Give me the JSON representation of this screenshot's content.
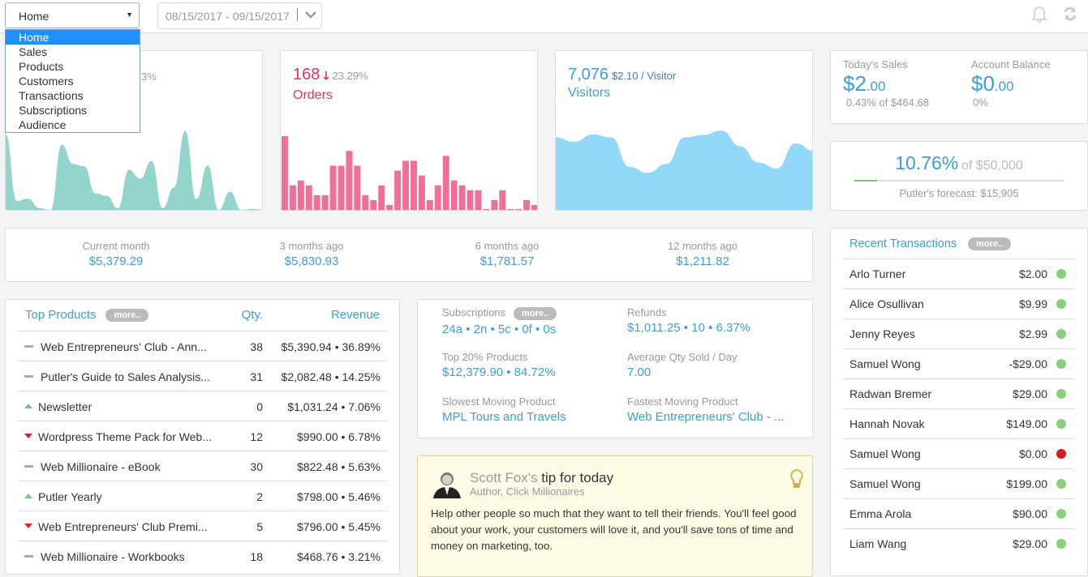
{
  "nav": {
    "selected": "Home",
    "options": [
      "Home",
      "Sales",
      "Products",
      "Customers",
      "Transactions",
      "Subscriptions",
      "Audience"
    ],
    "date_start": "08/15/2017",
    "date_sep": "-",
    "date_end": "09/15/2017"
  },
  "icons": {
    "bell": "bell-icon",
    "refresh": "refresh-icon",
    "chevron": "chevron-down-icon",
    "bulb": "lightbulb-icon"
  },
  "colors": {
    "accent": "#3d9de0",
    "orders": "#f06f97",
    "orders_text": "#e8335b",
    "sales": "#93d5cc",
    "visitors": "#92d9f9",
    "up": "#7bc67b",
    "down": "#dd2222",
    "success": "#86d17a",
    "fail": "#dd1a1a"
  },
  "sales": {
    "change_fragment": "3%"
  },
  "orders": {
    "count": "168",
    "change": "23.29%",
    "label": "Orders",
    "direction": "down"
  },
  "visitors": {
    "count": "7,076",
    "per_visitor": "$2.10 / Visitor",
    "label": "Visitors"
  },
  "chart_data": [
    {
      "type": "area",
      "series": [
        {
          "values": [
            256,
            30,
            38,
            6,
            0,
            221,
            156,
            148,
            56,
            48,
            6,
            136,
            106,
            166,
            6,
            76,
            268,
            36,
            151,
            0,
            62,
            0,
            3,
            0
          ]
        }
      ]
    },
    {
      "type": "bar",
      "series": [
        {
          "values": [
            15,
            5,
            6,
            5,
            3,
            3,
            9,
            9,
            12,
            9,
            3,
            2,
            5,
            1,
            8,
            10,
            10,
            7,
            2,
            5,
            11,
            6,
            5,
            4,
            4,
            0,
            2,
            4,
            0,
            0,
            2,
            1
          ]
        }
      ]
    },
    {
      "type": "area",
      "series": [
        {
          "values": [
            246,
            231,
            256,
            246,
            146,
            126,
            156,
            246,
            254,
            269,
            216,
            161,
            141,
            226,
            201
          ]
        }
      ]
    }
  ],
  "today": {
    "sales_label": "Today's Sales",
    "sales_main": "$2",
    "sales_cents": ".00",
    "sales_sub": "0.43% of $464.68",
    "balance_label": "Account Balance",
    "balance_main": "$0",
    "balance_cents": ".00",
    "balance_sub": "0%"
  },
  "forecast": {
    "percent": "10.76%",
    "of": "of $50,000",
    "progress": 10.76,
    "text": "Putler's forecast: $15,905"
  },
  "months": [
    {
      "label": "Current month",
      "value": "$5,379.29"
    },
    {
      "label": "3 months ago",
      "value": "$5,830.93"
    },
    {
      "label": "6 months ago",
      "value": "$1,781.57"
    },
    {
      "label": "12 months ago",
      "value": "$1,211.82"
    }
  ],
  "top_products": {
    "title": "Top Products",
    "more": "more..",
    "qty_header": "Qty.",
    "revenue_header": "Revenue",
    "rows": [
      {
        "trend": "flat",
        "name": "Web Entrepreneurs' Club - Ann...",
        "qty": "38",
        "revenue": "$5,390.94 • 36.89%"
      },
      {
        "trend": "flat",
        "name": "Putler's Guide to Sales Analysis...",
        "qty": "31",
        "revenue": "$2,082.48 • 14.25%"
      },
      {
        "trend": "up",
        "name": "Newsletter",
        "qty": "0",
        "revenue": "$1,031.24 • 7.06%"
      },
      {
        "trend": "down",
        "name": "Wordpress Theme Pack for Web...",
        "qty": "12",
        "revenue": "$990.00 • 6.78%"
      },
      {
        "trend": "flat",
        "name": "Web Millionaire - eBook",
        "qty": "30",
        "revenue": "$822.48 • 5.63%"
      },
      {
        "trend": "up",
        "name": "Putler Yearly",
        "qty": "2",
        "revenue": "$798.00 • 5.46%"
      },
      {
        "trend": "down",
        "name": "Web Entrepreneurs' Club Premi...",
        "qty": "5",
        "revenue": "$796.00 • 5.45%"
      },
      {
        "trend": "flat",
        "name": "Web Millionaire - Workbooks",
        "qty": "18",
        "revenue": "$468.76 • 3.21%"
      }
    ]
  },
  "stats": {
    "more": "more..",
    "items": [
      {
        "label": "Subscriptions",
        "value": "24a • 2n • 5c • 0f • 0s"
      },
      {
        "label": "Refunds",
        "value": "$1,011.25 • 10 • 6.37%"
      },
      {
        "label": "Top 20% Products",
        "value": "$12,379.90 • 84.72%"
      },
      {
        "label": "Average Qty Sold / Day",
        "value": "7.00"
      },
      {
        "label": "Slowest Moving Product",
        "value": "MPL Tours and Travels"
      },
      {
        "label": "Fastest Moving Product",
        "value": "Web Entrepreneurs' Club - ..."
      }
    ]
  },
  "tip": {
    "author": "Scott Fox's",
    "title": "tip for today",
    "role": "Author, Click Millionaires",
    "text": "Help other people so much that they want to tell their friends. You'll feel good about your work, your customers will love it, and you'll save tons of time and money on marketing, too."
  },
  "transactions": {
    "title": "Recent Transactions",
    "more": "more..",
    "rows": [
      {
        "name": "Arlo Turner",
        "amount": "$2.00",
        "status": "success"
      },
      {
        "name": "Alice Osullivan",
        "amount": "$9.99",
        "status": "success"
      },
      {
        "name": "Jenny Reyes",
        "amount": "$2.99",
        "status": "success"
      },
      {
        "name": "Samuel Wong",
        "amount": "-$29.00",
        "status": "success"
      },
      {
        "name": "Radwan Bremer",
        "amount": "$29.00",
        "status": "success"
      },
      {
        "name": "Hannah Novak",
        "amount": "$149.00",
        "status": "success"
      },
      {
        "name": "Samuel Wong",
        "amount": "$0.00",
        "status": "fail"
      },
      {
        "name": "Samuel Wong",
        "amount": "$199.00",
        "status": "success"
      },
      {
        "name": "Emma Arola",
        "amount": "$90.00",
        "status": "success"
      },
      {
        "name": "Liam Wang",
        "amount": "$29.00",
        "status": "success"
      }
    ]
  }
}
